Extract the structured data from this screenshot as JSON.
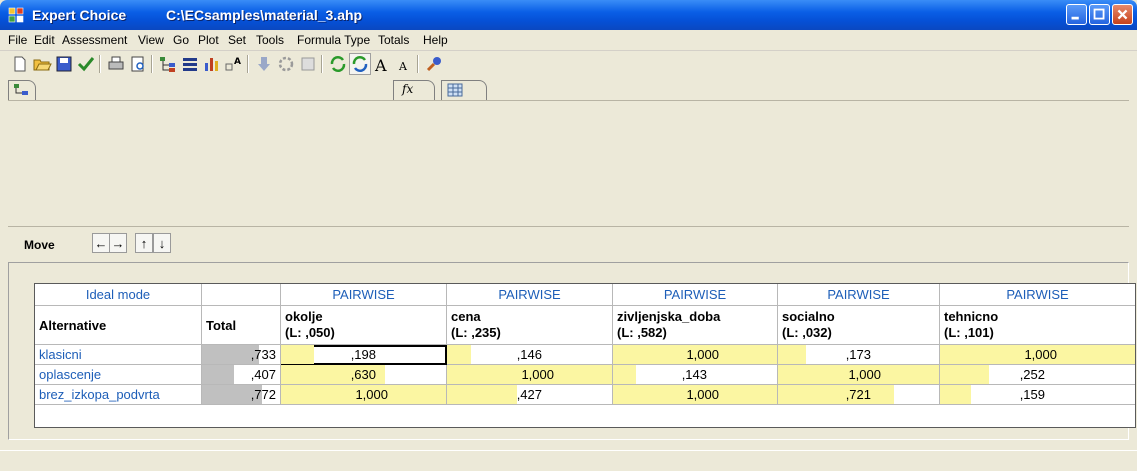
{
  "window": {
    "app_title": "Expert Choice",
    "file_path": "C:\\ECsamples\\material_3.ahp"
  },
  "menu": [
    "File",
    "Edit",
    "Assessment",
    "View",
    "Go",
    "Plot",
    "Set",
    "Tools",
    "Formula Type",
    "Totals",
    "Help"
  ],
  "toolbar_icons": [
    "new-icon",
    "open-icon",
    "save-icon",
    "check-icon",
    "print-icon",
    "print-preview-icon",
    "tree-icon",
    "list-icon",
    "bar-chart-icon",
    "font-size-icon",
    "arrow-down-icon",
    "gear-icon",
    "calculator-icon",
    "sync-icon",
    "sync-pressed-icon",
    "font-larger-icon",
    "font-smaller-icon",
    "tool-icon"
  ],
  "tabs": {
    "tab1_icon": "tree-view-icon",
    "tab2_icon": "formula-icon",
    "tab3_icon": "grid-icon",
    "formula_glyph": "fx"
  },
  "move": {
    "label": "Move",
    "left": "←",
    "right": "→",
    "up": "↑",
    "down": "↓"
  },
  "grid": {
    "mode_label": "Ideal mode",
    "alt_header": "Alternative",
    "total_header": "Total",
    "criteria": [
      {
        "method": "PAIRWISE",
        "name": "okolje",
        "local": "(L: ,050)"
      },
      {
        "method": "PAIRWISE",
        "name": "cena",
        "local": "(L: ,235)"
      },
      {
        "method": "PAIRWISE",
        "name": "zivljenjska_doba",
        "local": "(L: ,582)"
      },
      {
        "method": "PAIRWISE",
        "name": "socialno",
        "local": "(L: ,032)"
      },
      {
        "method": "PAIRWISE",
        "name": "tehnicno",
        "local": "(L: ,101)"
      }
    ],
    "rows": [
      {
        "name": "klasicni",
        "total": ",733",
        "total_frac": 0.733,
        "values": [
          ",198",
          ",146",
          "1,000",
          ",173",
          "1,000"
        ],
        "fracs": [
          0.198,
          0.146,
          1.0,
          0.173,
          1.0
        ]
      },
      {
        "name": "oplascenje",
        "total": ",407",
        "total_frac": 0.407,
        "values": [
          ",630",
          "1,000",
          ",143",
          "1,000",
          ",252"
        ],
        "fracs": [
          0.63,
          1.0,
          0.143,
          1.0,
          0.252
        ]
      },
      {
        "name": "brez_izkopa_podvrta",
        "total": ",772",
        "total_frac": 0.772,
        "values": [
          "1,000",
          ",427",
          "1,000",
          ",721",
          ",159"
        ],
        "fracs": [
          1.0,
          0.427,
          1.0,
          0.721,
          0.159
        ]
      }
    ]
  },
  "colors": {
    "bar_yellow": "#fbf6a2",
    "bar_gray": "#c0c0c0",
    "link_blue": "#1d5eb8"
  }
}
